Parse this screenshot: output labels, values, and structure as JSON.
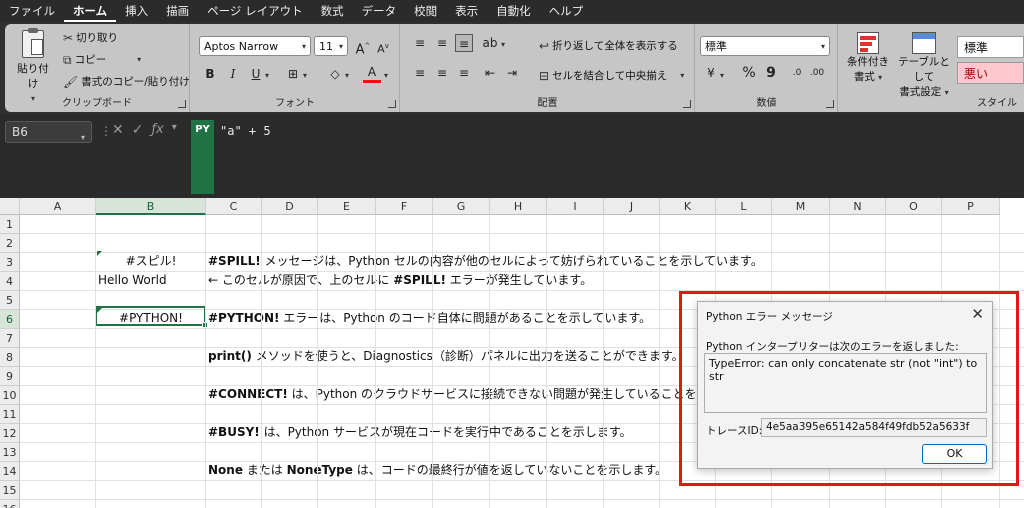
{
  "menu": {
    "items": [
      "ファイル",
      "ホーム",
      "挿入",
      "描画",
      "ページ レイアウト",
      "数式",
      "データ",
      "校閲",
      "表示",
      "自動化",
      "ヘルプ"
    ],
    "active_index": 1
  },
  "ribbon": {
    "clipboard": {
      "paste": "貼り付け",
      "cut": "切り取り",
      "copy": "コピー",
      "format_painter": "書式のコピー/貼り付け",
      "label": "クリップボード"
    },
    "font": {
      "name": "Aptos Narrow",
      "size": "11",
      "grow": "A",
      "shrink": "A",
      "bold": "B",
      "italic": "I",
      "underline": "U",
      "font_color": "A",
      "label": "フォント"
    },
    "alignment": {
      "wrap": "折り返して全体を表示する",
      "merge": "セルを結合して中央揃え",
      "label": "配置"
    },
    "number": {
      "format": "標準",
      "percent": "%",
      "comma": "9",
      "label": "数値"
    },
    "styles": {
      "conditional": [
        "条件付き",
        "書式"
      ],
      "table": [
        "テーブルとして",
        "書式設定"
      ],
      "normal": "標準",
      "bad": "悪い",
      "label": "スタイル"
    }
  },
  "formula_bar": {
    "name_box": "B6",
    "badge": "PY",
    "formula": "\"a\" + 5"
  },
  "grid": {
    "columns": [
      "A",
      "B",
      "C",
      "D",
      "E",
      "F",
      "G",
      "H",
      "I",
      "J",
      "K",
      "L",
      "M",
      "N",
      "O",
      "P"
    ],
    "rows": [
      "1",
      "2",
      "3",
      "4",
      "5",
      "6",
      "7",
      "8",
      "9",
      "10",
      "11",
      "12",
      "13",
      "14",
      "15",
      "16"
    ],
    "selected_col": "B",
    "selected_row": "6",
    "cells": {
      "b3": "#スピル!",
      "b4": "Hello World",
      "b6": "#PYTHON!",
      "c3": {
        "bold": "#SPILL!",
        "rest": " メッセージは、Python セルの内容が他のセルによって妨げられていることを示しています。"
      },
      "c4": {
        "pre": "← このセルが原因で、上のセルに ",
        "bold": "#SPILL!",
        "rest": " エラーが発生しています。"
      },
      "c6": {
        "bold": "#PYTHON!",
        "rest": " エラーは、Python のコード自体に問題があることを示しています。"
      },
      "c8": {
        "bold": "print()",
        "rest": " メソッドを使うと、Diagnostics（診断）パネルに出力を送ることができます。"
      },
      "c10": {
        "bold": "#CONNECT!",
        "rest": " は、Python のクラウドサービスに接続できない問題が発生していることを示しています。"
      },
      "c12": {
        "bold": "#BUSY!",
        "rest": " は、Python サービスが現在コードを実行中であることを示します。"
      },
      "c14": {
        "bold1": "None",
        "mid": " または ",
        "bold2": "NoneType",
        "rest": " は、コードの最終行が値を返していないことを示します。"
      }
    }
  },
  "dialog": {
    "title": "Python エラー メッセージ",
    "message": "Python インタープリターは次のエラーを返しました:",
    "error_text": "TypeError: can only concatenate str (not \"int\") to str",
    "trace_label": "トレースID:",
    "trace_id": "4e5aa395e65142a584f49fdb52a5633f",
    "ok": "OK"
  }
}
